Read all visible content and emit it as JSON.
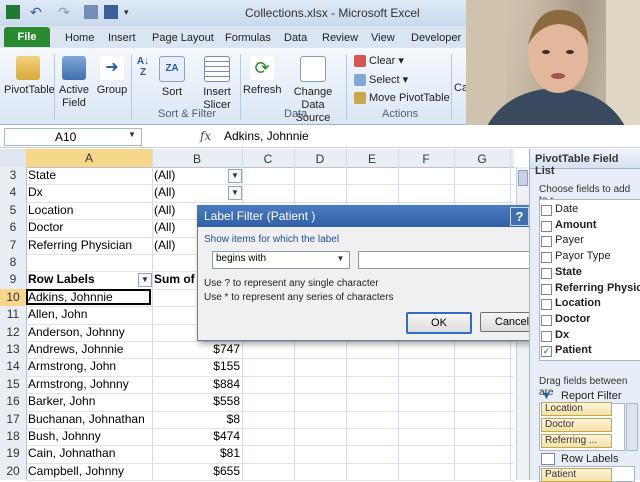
{
  "window": {
    "title": "Collections.xlsx - Microsoft Excel"
  },
  "ribbon": {
    "tabs": [
      "File",
      "Home",
      "Insert",
      "Page Layout",
      "Formulas",
      "Data",
      "Review",
      "View",
      "Developer"
    ],
    "buttons": {
      "pivottable": "PivotTable",
      "active_field": "Active Field",
      "group": "Group",
      "sort": "Sort",
      "insert_slicer": "Insert Slicer",
      "refresh": "Refresh",
      "change_data_source": "Change Data Source",
      "clear": "Clear",
      "select": "Select",
      "move_pivottable": "Move PivotTable",
      "calc_partial": "Cal"
    },
    "groups": {
      "sort_filter": "Sort & Filter",
      "data": "Data",
      "actions": "Actions"
    }
  },
  "formula_bar": {
    "name_box": "A10",
    "fx": "fx",
    "content": "Adkins, Johnnie"
  },
  "grid": {
    "columns": [
      "A",
      "B",
      "C",
      "D",
      "E",
      "F",
      "G"
    ],
    "rows": [
      {
        "num": "3",
        "a": "State",
        "b": "(All)",
        "dropdown": true
      },
      {
        "num": "4",
        "a": "Dx",
        "b": "(All)",
        "dropdown": true
      },
      {
        "num": "5",
        "a": "Location",
        "b": "(All)",
        "dropdown": false
      },
      {
        "num": "6",
        "a": "Doctor",
        "b": "(All)",
        "dropdown": false
      },
      {
        "num": "7",
        "a": "Referring Physician",
        "b": "(All)",
        "dropdown": false
      },
      {
        "num": "8",
        "a": "",
        "b": "",
        "dropdown": false
      },
      {
        "num": "9",
        "a": "Row Labels",
        "b": "Sum of A",
        "dropdown": false
      },
      {
        "num": "10",
        "a": "Adkins, Johnnie",
        "b": "",
        "dropdown": false
      },
      {
        "num": "11",
        "a": "Allen, John",
        "b": "",
        "dropdown": false
      },
      {
        "num": "12",
        "a": "Anderson, Johnny",
        "b": "",
        "dropdown": false
      },
      {
        "num": "13",
        "a": "Andrews, Johnnie",
        "b": "$747",
        "dropdown": false
      },
      {
        "num": "14",
        "a": "Armstrong, John",
        "b": "$155",
        "dropdown": false
      },
      {
        "num": "15",
        "a": "Armstrong, Johnny",
        "b": "$884",
        "dropdown": false
      },
      {
        "num": "16",
        "a": "Barker, John",
        "b": "$558",
        "dropdown": false
      },
      {
        "num": "17",
        "a": "Buchanan, Johnathan",
        "b": "$8",
        "dropdown": false
      },
      {
        "num": "18",
        "a": "Bush, Johnny",
        "b": "$474",
        "dropdown": false
      },
      {
        "num": "19",
        "a": "Cain, Johnathan",
        "b": "$81",
        "dropdown": false
      },
      {
        "num": "20",
        "a": "Campbell, Johnny",
        "b": "$655",
        "dropdown": false
      }
    ]
  },
  "dialog": {
    "title": "Label Filter (Patient )",
    "help": "?",
    "close": "X",
    "instruction": "Show items for which the label",
    "operator": "begins with",
    "value": "",
    "hint1": "Use ? to represent any single character",
    "hint2": "Use * to represent any series of characters",
    "ok": "OK",
    "cancel": "Cancel"
  },
  "field_list": {
    "title": "PivotTable Field List",
    "choose": "Choose fields to add to r",
    "fields": [
      {
        "name": "Date",
        "bold": false,
        "checked": false
      },
      {
        "name": "Amount",
        "bold": true,
        "checked": false
      },
      {
        "name": "Payer",
        "bold": false,
        "checked": false
      },
      {
        "name": "Payor Type",
        "bold": false,
        "checked": false
      },
      {
        "name": "State",
        "bold": true,
        "checked": false
      },
      {
        "name": "Referring Physici",
        "bold": true,
        "checked": false
      },
      {
        "name": "Location",
        "bold": true,
        "checked": false
      },
      {
        "name": "Doctor",
        "bold": true,
        "checked": false
      },
      {
        "name": "Dx",
        "bold": true,
        "checked": false
      },
      {
        "name": "Patient",
        "bold": true,
        "checked": true
      }
    ],
    "drag_text": "Drag fields between are",
    "report_filter": "Report Filter",
    "report_filter_items": [
      "Location",
      "Doctor",
      "Referring ..."
    ],
    "row_labels": "Row Labels",
    "row_label_items": [
      "Patient"
    ]
  }
}
